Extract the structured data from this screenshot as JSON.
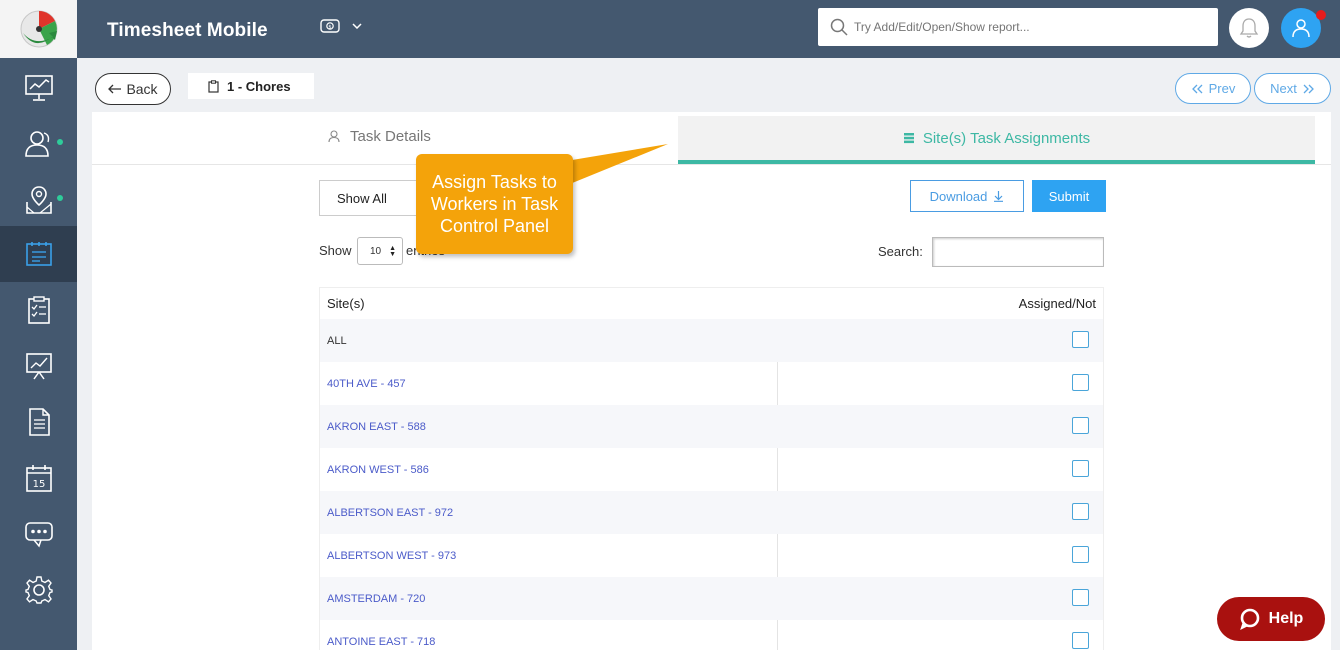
{
  "header": {
    "title": "Timesheet Mobile",
    "currency_icon": "currency-icon",
    "search_placeholder": "Try Add/Edit/Open/Show report..."
  },
  "sidebar": {
    "items": [
      {
        "icon": "dashboard-monitor-icon",
        "active": false,
        "dot": false
      },
      {
        "icon": "users-icon",
        "active": false,
        "dot": true
      },
      {
        "icon": "map-location-icon",
        "active": false,
        "dot": true
      },
      {
        "icon": "tasks-board-icon",
        "active": true,
        "dot": false
      },
      {
        "icon": "clipboard-checklist-icon",
        "active": false,
        "dot": false
      },
      {
        "icon": "presentation-chart-icon",
        "active": false,
        "dot": false
      },
      {
        "icon": "document-icon",
        "active": false,
        "dot": false
      },
      {
        "icon": "calendar-icon",
        "active": false,
        "dot": false,
        "label": "15"
      },
      {
        "icon": "chat-icon",
        "active": false,
        "dot": false
      },
      {
        "icon": "settings-gear-icon",
        "active": false,
        "dot": false
      }
    ]
  },
  "subheader": {
    "back_label": "Back",
    "breadcrumb": "1 - Chores",
    "prev_label": "Prev",
    "next_label": "Next"
  },
  "tabs": {
    "details": "Task Details",
    "sites": "Site(s) Task Assignments"
  },
  "controls": {
    "filter_value": "Show All",
    "download_label": "Download",
    "submit_label": "Submit",
    "show_label": "Show",
    "entries_value": "10",
    "entries_label": "entries",
    "search_label": "Search:"
  },
  "table": {
    "col_site": "Site(s)",
    "col_assigned": "Assigned/Not",
    "rows": [
      {
        "site": "ALL",
        "checked": false
      },
      {
        "site": "40TH AVE - 457",
        "checked": false
      },
      {
        "site": "AKRON EAST - 588",
        "checked": false
      },
      {
        "site": "AKRON WEST - 586",
        "checked": false
      },
      {
        "site": "ALBERTSON EAST - 972",
        "checked": false
      },
      {
        "site": "ALBERTSON WEST - 973",
        "checked": false
      },
      {
        "site": "AMSTERDAM - 720",
        "checked": false
      },
      {
        "site": "ANTOINE EAST - 718",
        "checked": false
      }
    ]
  },
  "callout": {
    "text": "Assign Tasks to Workers in Task Control Panel"
  },
  "help": {
    "label": "Help"
  },
  "colors": {
    "header_bg": "#44586f",
    "accent_teal": "#3db8a4",
    "primary_blue": "#2ea3f2",
    "callout_orange": "#f4a30a",
    "help_red": "#a9110f"
  }
}
